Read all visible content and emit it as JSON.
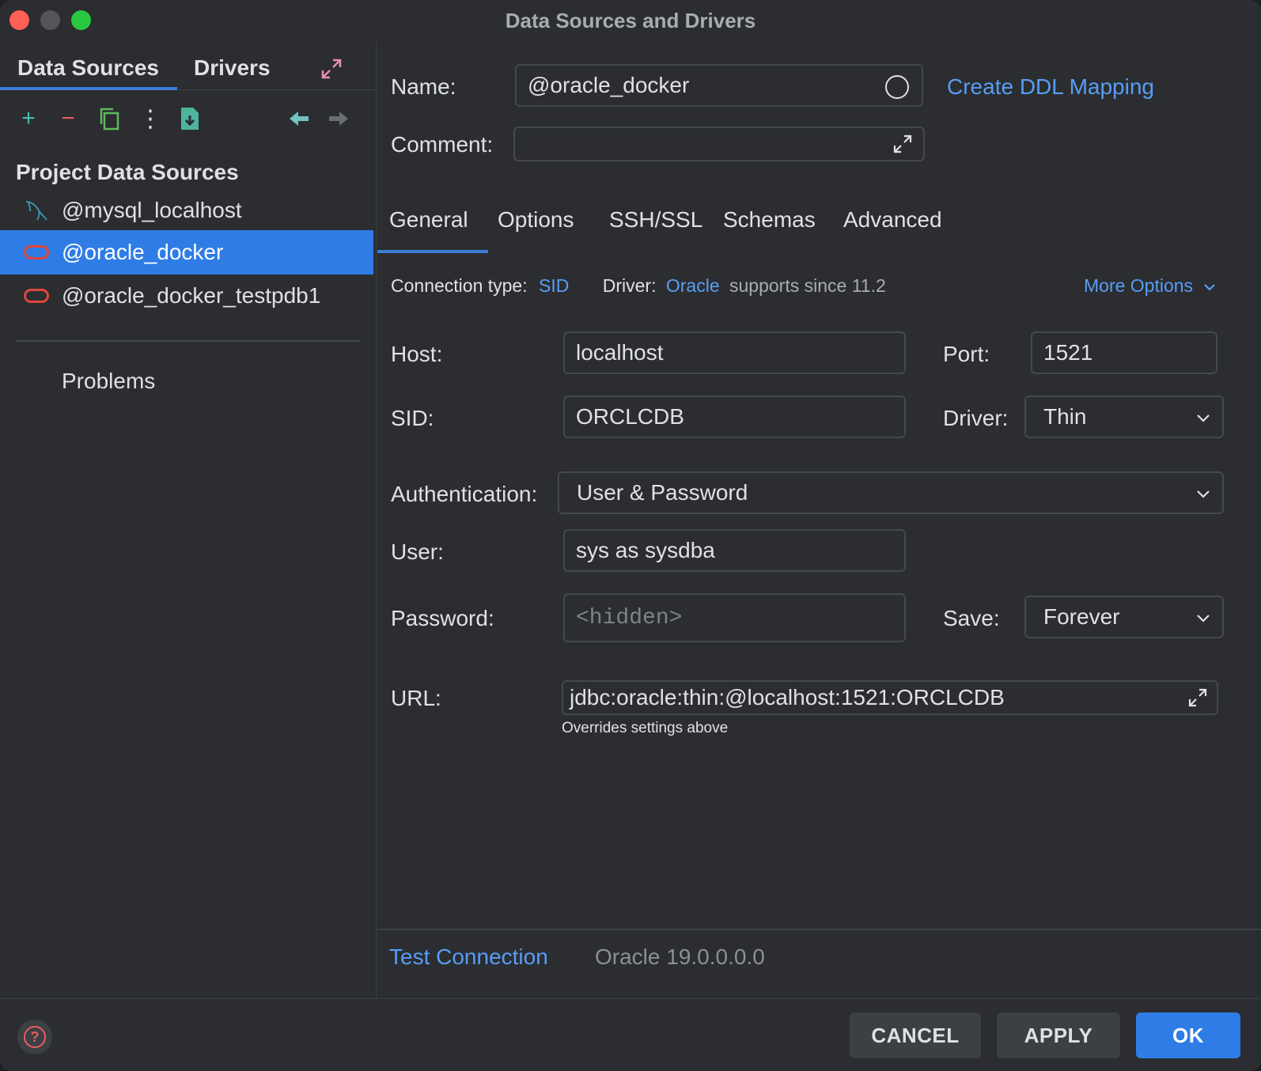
{
  "window": {
    "title": "Data Sources and Drivers",
    "traffic_lights": {
      "close": "#fe5f57",
      "minimize": "#555557",
      "zoom": "#29c840"
    }
  },
  "left_panel": {
    "tabs": [
      {
        "label": "Data Sources",
        "active": true
      },
      {
        "label": "Drivers",
        "active": false
      }
    ],
    "expand_icon": "expand-arrows-icon",
    "toolbar": {
      "add_icon": "+",
      "remove_icon": "−",
      "copy_icon": "copy-icon",
      "more_icon": "⋮",
      "import_icon": "import-file-icon",
      "back_icon": "arrow-left-icon",
      "forward_icon": "arrow-right-icon"
    },
    "section_title": "Project Data Sources",
    "items": [
      {
        "label": "@mysql_localhost",
        "icon": "mysql-dolphin-icon",
        "selected": false
      },
      {
        "label": "@oracle_docker",
        "icon": "oracle-icon",
        "selected": true
      },
      {
        "label": "@oracle_docker_testpdb1",
        "icon": "oracle-icon",
        "selected": false
      }
    ],
    "problems_label": "Problems"
  },
  "form": {
    "name_label": "Name:",
    "name_value": "@oracle_docker",
    "create_ddl_link": "Create DDL Mapping",
    "comment_label": "Comment:",
    "comment_value": "",
    "tabs": [
      {
        "label": "General",
        "active": true
      },
      {
        "label": "Options",
        "active": false
      },
      {
        "label": "SSH/SSL",
        "active": false
      },
      {
        "label": "Schemas",
        "active": false
      },
      {
        "label": "Advanced",
        "active": false
      }
    ],
    "connection_type_label": "Connection type:",
    "connection_type_value": "SID",
    "driver_info_label": "Driver:",
    "driver_info_value": "Oracle",
    "driver_info_note": "supports since 11.2",
    "more_options": "More Options",
    "host_label": "Host:",
    "host_value": "localhost",
    "port_label": "Port:",
    "port_value": "1521",
    "sid_label": "SID:",
    "sid_value": "ORCLCDB",
    "driver_label": "Driver:",
    "driver_value": "Thin",
    "auth_label": "Authentication:",
    "auth_value": "User & Password",
    "user_label": "User:",
    "user_value": "sys as sysdba",
    "password_label": "Password:",
    "password_placeholder": "<hidden>",
    "save_label": "Save:",
    "save_value": "Forever",
    "url_label": "URL:",
    "url_value": "jdbc:oracle:thin:@localhost:1521:ORCLCDB",
    "url_note": "Overrides settings above",
    "test_connection": "Test Connection",
    "server_version": "Oracle 19.0.0.0.0"
  },
  "footer": {
    "help_icon": "?",
    "cancel": "CANCEL",
    "apply": "APPLY",
    "ok": "OK"
  },
  "colors": {
    "accent": "#2f7ce6",
    "link": "#589df6",
    "oracle_red": "#e1473c",
    "add_green": "#3fbfb3",
    "remove_red": "#e45e5e"
  }
}
